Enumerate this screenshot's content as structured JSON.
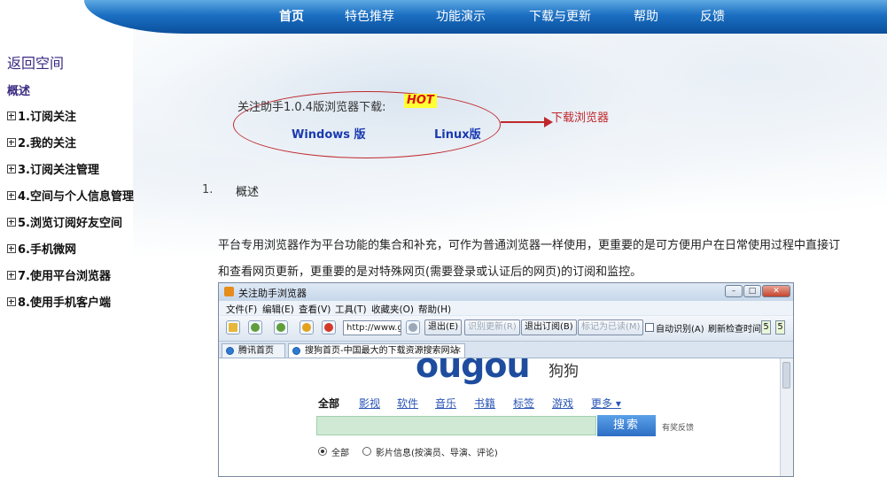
{
  "topnav": {
    "items": [
      "首页",
      "特色推荐",
      "功能演示",
      "下载与更新",
      "帮助",
      "反馈"
    ],
    "active": "首页"
  },
  "sidebar": {
    "back": "返回空间",
    "overview": "概述",
    "items": [
      "1.订阅关注",
      "2.我的关注",
      "3.订阅关注管理",
      "4.空间与个人信息管理",
      "5.浏览订阅好友空间",
      "6.手机微网",
      "7.使用平台浏览器",
      "8.使用手机客户端"
    ]
  },
  "download": {
    "label": "关注助手1.0.4版浏览器下载:",
    "hot": "HOT",
    "windows": "Windows 版",
    "linux": "Linux版",
    "arrow_label": "下载浏览器"
  },
  "section": {
    "number": "1.",
    "title": "概述",
    "para_line1": "平台专用浏览器作为平台功能的集合和补充，可作为普通浏览器一样使用，更重要的是可方便用户在日常使用过程中直接订",
    "para_line2": "和查看网页更新，更重要的是对特殊网页(需要登录或认证后的网页)的订阅和监控。"
  },
  "screenshot": {
    "title": "关注助手浏览器",
    "menu": [
      "文件(F)",
      "编辑(E)",
      "查看(V)",
      "工具(T)",
      "收藏夹(O)",
      "帮助(H)"
    ],
    "url": "http://www.gc",
    "buttons": {
      "exit": "退出(E)",
      "identify_update": "识别更新(R)",
      "exit_subscribe": "退出订阅(B)",
      "mark_read": "标记为已读(M)",
      "auto_identify": "自动识别(A)",
      "refresh_interval": "刷新检查时间",
      "interval_values": [
        "5",
        "5"
      ]
    },
    "tabs": [
      "腾讯首页",
      "搜狗首页-中国最大的下载资源搜索网站"
    ],
    "page": {
      "logo": "ougou",
      "logo_cn": "狗狗",
      "nav": [
        "全部",
        "影视",
        "软件",
        "音乐",
        "书籍",
        "标签",
        "游戏",
        "更多 ▾"
      ],
      "search_button": "搜索",
      "feedback": "有奖反馈",
      "radio_all": "全部",
      "radio_movie": "影片信息(按演员、导演、评论)"
    }
  },
  "colors": {
    "nav_blue": "#1b6fc2",
    "sidebar_link": "#3a2a82",
    "annotation_red": "#c0282c",
    "hot_bg": "#ffff33",
    "download_link": "#1a3ab0"
  }
}
